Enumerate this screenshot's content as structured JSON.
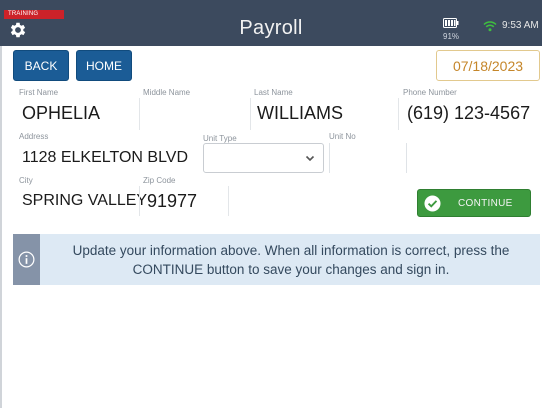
{
  "header": {
    "training_label": "TRAINING",
    "title": "Payroll",
    "battery_percent": "91%",
    "time": "9:53 AM",
    "bar_color": "#3c4a5e"
  },
  "toolbar": {
    "back_label": "BACK",
    "home_label": "HOME",
    "date": "07/18/2023"
  },
  "form": {
    "first_name": {
      "label": "First Name",
      "value": "OPHELIA"
    },
    "middle_name": {
      "label": "Middle Name",
      "value": ""
    },
    "last_name": {
      "label": "Last Name",
      "value": "WILLIAMS"
    },
    "phone": {
      "label": "Phone Number",
      "value": "(619) 123-4567"
    },
    "address": {
      "label": "Address",
      "value": "1128 ELKELTON BLVD"
    },
    "unit_type": {
      "label": "Unit Type",
      "value": ""
    },
    "unit_no": {
      "label": "Unit No",
      "value": ""
    },
    "city": {
      "label": "City",
      "value": "SPRING VALLEY"
    },
    "zip": {
      "label": "Zip Code",
      "value": "91977"
    }
  },
  "continue_label": "CONTINUE",
  "banner": {
    "text": "Update your information above. When all information is correct, press the CONTINUE button to save your changes and sign in."
  },
  "icons": [
    "gear-icon",
    "battery-icon",
    "wifi-icon",
    "check-circle-icon",
    "chevron-down-icon",
    "info-icon"
  ],
  "colors": {
    "primary_button": "#1b5c96",
    "continue_button": "#3d9a3f",
    "date_text": "#c5862a",
    "banner_bg": "#dde9f4",
    "training_badge": "#cc2229"
  }
}
